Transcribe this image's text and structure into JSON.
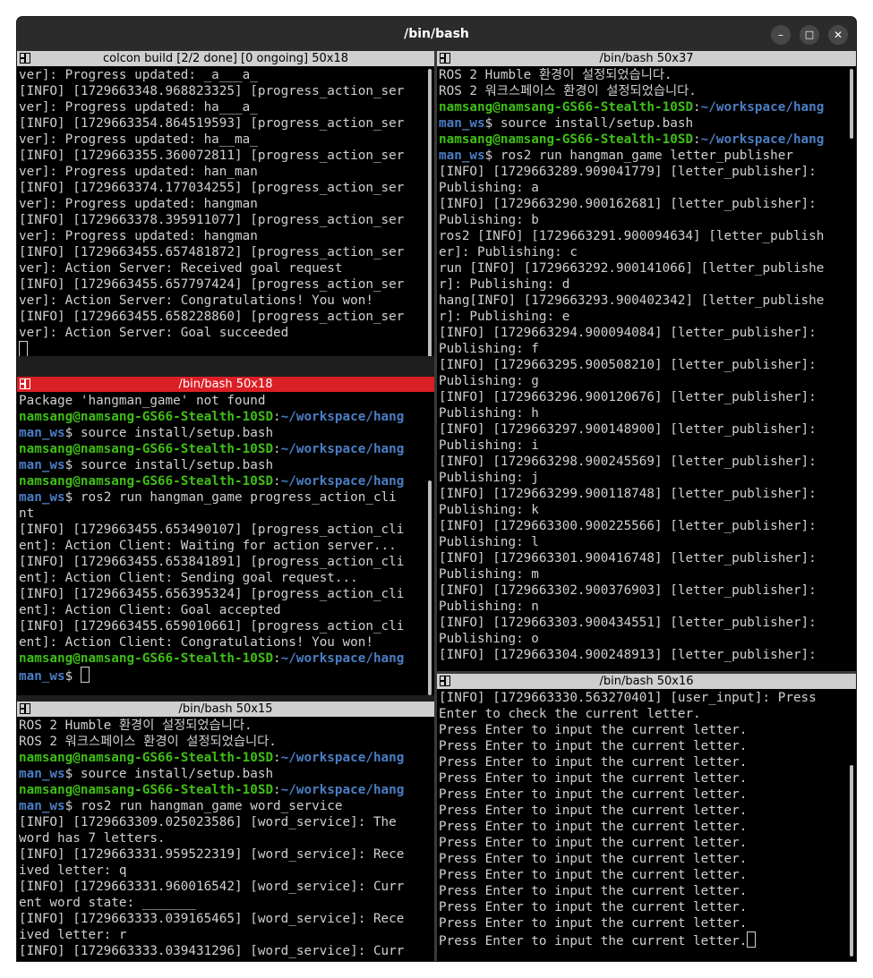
{
  "window": {
    "title": "/bin/bash",
    "minimize": "–",
    "maximize": "□",
    "close": "✕"
  },
  "panes": {
    "tl": {
      "title": "colcon build [2/2 done] [0 ongoing] 50x18",
      "lines": [
        [
          {
            "t": "ver]: Progress updated: _a___a_"
          }
        ],
        [
          {
            "t": "[INFO] [1729663348.968823325] [progress_action_ser"
          }
        ],
        [
          {
            "t": "ver]: Progress updated: ha___a_"
          }
        ],
        [
          {
            "t": "[INFO] [1729663354.864519593] [progress_action_ser"
          }
        ],
        [
          {
            "t": "ver]: Progress updated: ha__ma_"
          }
        ],
        [
          {
            "t": "[INFO] [1729663355.360072811] [progress_action_ser"
          }
        ],
        [
          {
            "t": "ver]: Progress updated: han_man"
          }
        ],
        [
          {
            "t": "[INFO] [1729663374.177034255] [progress_action_ser"
          }
        ],
        [
          {
            "t": "ver]: Progress updated: hangman"
          }
        ],
        [
          {
            "t": "[INFO] [1729663378.395911077] [progress_action_ser"
          }
        ],
        [
          {
            "t": "ver]: Progress updated: hangman"
          }
        ],
        [
          {
            "t": "[INFO] [1729663455.657481872] [progress_action_ser"
          }
        ],
        [
          {
            "t": "ver]: Action Server: Received goal request"
          }
        ],
        [
          {
            "t": "[INFO] [1729663455.657797424] [progress_action_ser"
          }
        ],
        [
          {
            "t": "ver]: Action Server: Congratulations! You won!"
          }
        ],
        [
          {
            "t": "[INFO] [1729663455.658228860] [progress_action_ser"
          }
        ],
        [
          {
            "t": "ver]: Action Server: Goal succeeded"
          }
        ]
      ]
    },
    "ml": {
      "title": "/bin/bash 50x18",
      "lines": [
        [
          {
            "t": "Package 'hangman_game' not found"
          }
        ],
        [
          {
            "t": "namsang@namsang-GS66-Stealth-10SD",
            "c": "g"
          },
          {
            "t": ":"
          },
          {
            "t": "~/workspace/hang",
            "c": "b"
          }
        ],
        [
          {
            "t": "man_ws",
            "c": "b"
          },
          {
            "t": "$ source install/setup.bash"
          }
        ],
        [
          {
            "t": "namsang@namsang-GS66-Stealth-10SD",
            "c": "g"
          },
          {
            "t": ":"
          },
          {
            "t": "~/workspace/hang",
            "c": "b"
          }
        ],
        [
          {
            "t": "man_ws",
            "c": "b"
          },
          {
            "t": "$ source install/setup.bash"
          }
        ],
        [
          {
            "t": "namsang@namsang-GS66-Stealth-10SD",
            "c": "g"
          },
          {
            "t": ":"
          },
          {
            "t": "~/workspace/hang",
            "c": "b"
          }
        ],
        [
          {
            "t": "man_ws",
            "c": "b"
          },
          {
            "t": "$ ros2 run hangman_game progress_action_cli"
          }
        ],
        [
          {
            "t": "nt"
          }
        ],
        [
          {
            "t": "[INFO] [1729663455.653490107] [progress_action_cli"
          }
        ],
        [
          {
            "t": "ent]: Action Client: Waiting for action server..."
          }
        ],
        [
          {
            "t": "[INFO] [1729663455.653841891] [progress_action_cli"
          }
        ],
        [
          {
            "t": "ent]: Action Client: Sending goal request..."
          }
        ],
        [
          {
            "t": "[INFO] [1729663455.656395324] [progress_action_cli"
          }
        ],
        [
          {
            "t": "ent]: Action Client: Goal accepted"
          }
        ],
        [
          {
            "t": "[INFO] [1729663455.659010661] [progress_action_cli"
          }
        ],
        [
          {
            "t": "ent]: Action Client: Congratulations! You won!"
          }
        ],
        [
          {
            "t": "namsang@namsang-GS66-Stealth-10SD",
            "c": "g"
          },
          {
            "t": ":"
          },
          {
            "t": "~/workspace/hang",
            "c": "b"
          }
        ],
        [
          {
            "t": "man_ws",
            "c": "b"
          },
          {
            "t": "$ "
          }
        ]
      ]
    },
    "bl": {
      "title": "/bin/bash 50x15",
      "lines": [
        [
          {
            "t": "ROS 2 Humble 환경이 설정되었습니다."
          }
        ],
        [
          {
            "t": "ROS 2 워크스페이스 환경이 설정되었습니다."
          }
        ],
        [
          {
            "t": "namsang@namsang-GS66-Stealth-10SD",
            "c": "g"
          },
          {
            "t": ":"
          },
          {
            "t": "~/workspace/hang",
            "c": "b"
          }
        ],
        [
          {
            "t": "man_ws",
            "c": "b"
          },
          {
            "t": "$ source install/setup.bash"
          }
        ],
        [
          {
            "t": "namsang@namsang-GS66-Stealth-10SD",
            "c": "g"
          },
          {
            "t": ":"
          },
          {
            "t": "~/workspace/hang",
            "c": "b"
          }
        ],
        [
          {
            "t": "man_ws",
            "c": "b"
          },
          {
            "t": "$ ros2 run hangman_game word_service"
          }
        ],
        [
          {
            "t": "[INFO] [1729663309.025023586] [word_service]: The"
          }
        ],
        [
          {
            "t": "word has 7 letters."
          }
        ],
        [
          {
            "t": "[INFO] [1729663331.959522319] [word_service]: Rece"
          }
        ],
        [
          {
            "t": "ived letter: q"
          }
        ],
        [
          {
            "t": "[INFO] [1729663331.960016542] [word_service]: Curr"
          }
        ],
        [
          {
            "t": "ent word state: _______"
          }
        ],
        [
          {
            "t": "[INFO] [1729663333.039165465] [word_service]: Rece"
          }
        ],
        [
          {
            "t": "ived letter: r"
          }
        ],
        [
          {
            "t": "[INFO] [1729663333.039431296] [word_service]: Curr"
          }
        ]
      ]
    },
    "tr": {
      "title": "/bin/bash 50x37",
      "lines": [
        [
          {
            "t": "ROS 2 Humble 환경이 설정되었습니다."
          }
        ],
        [
          {
            "t": "ROS 2 워크스페이스 환경이 설정되었습니다."
          }
        ],
        [
          {
            "t": "namsang@namsang-GS66-Stealth-10SD",
            "c": "g"
          },
          {
            "t": ":"
          },
          {
            "t": "~/workspace/hang",
            "c": "b"
          }
        ],
        [
          {
            "t": "man_ws",
            "c": "b"
          },
          {
            "t": "$ source install/setup.bash"
          }
        ],
        [
          {
            "t": "namsang@namsang-GS66-Stealth-10SD",
            "c": "g"
          },
          {
            "t": ":"
          },
          {
            "t": "~/workspace/hang",
            "c": "b"
          }
        ],
        [
          {
            "t": "man_ws",
            "c": "b"
          },
          {
            "t": "$ ros2 run hangman_game letter_publisher"
          }
        ],
        [
          {
            "t": "[INFO] [1729663289.909041779] [letter_publisher]:"
          }
        ],
        [
          {
            "t": "Publishing: a"
          }
        ],
        [
          {
            "t": "[INFO] [1729663290.900162681] [letter_publisher]:"
          }
        ],
        [
          {
            "t": "Publishing: b"
          }
        ],
        [
          {
            "t": "ros2 [INFO] [1729663291.900094634] [letter_publish"
          }
        ],
        [
          {
            "t": "er]: Publishing: c"
          }
        ],
        [
          {
            "t": "run [INFO] [1729663292.900141066] [letter_publishe"
          }
        ],
        [
          {
            "t": "r]: Publishing: d"
          }
        ],
        [
          {
            "t": "hang[INFO] [1729663293.900402342] [letter_publishe"
          }
        ],
        [
          {
            "t": "r]: Publishing: e"
          }
        ],
        [
          {
            "t": "[INFO] [1729663294.900094084] [letter_publisher]:"
          }
        ],
        [
          {
            "t": "Publishing: f"
          }
        ],
        [
          {
            "t": "[INFO] [1729663295.900508210] [letter_publisher]:"
          }
        ],
        [
          {
            "t": "Publishing: g"
          }
        ],
        [
          {
            "t": "[INFO] [1729663296.900120676] [letter_publisher]:"
          }
        ],
        [
          {
            "t": "Publishing: h"
          }
        ],
        [
          {
            "t": "[INFO] [1729663297.900148900] [letter_publisher]:"
          }
        ],
        [
          {
            "t": "Publishing: i"
          }
        ],
        [
          {
            "t": "[INFO] [1729663298.900245569] [letter_publisher]:"
          }
        ],
        [
          {
            "t": "Publishing: j"
          }
        ],
        [
          {
            "t": "[INFO] [1729663299.900118748] [letter_publisher]:"
          }
        ],
        [
          {
            "t": "Publishing: k"
          }
        ],
        [
          {
            "t": "[INFO] [1729663300.900225566] [letter_publisher]:"
          }
        ],
        [
          {
            "t": "Publishing: l"
          }
        ],
        [
          {
            "t": "[INFO] [1729663301.900416748] [letter_publisher]:"
          }
        ],
        [
          {
            "t": "Publishing: m"
          }
        ],
        [
          {
            "t": "[INFO] [1729663302.900376903] [letter_publisher]:"
          }
        ],
        [
          {
            "t": "Publishing: n"
          }
        ],
        [
          {
            "t": "[INFO] [1729663303.900434551] [letter_publisher]:"
          }
        ],
        [
          {
            "t": "Publishing: o"
          }
        ],
        [
          {
            "t": "[INFO] [1729663304.900248913] [letter_publisher]:"
          }
        ]
      ]
    },
    "br": {
      "title": "/bin/bash 50x16",
      "lines": [
        [
          {
            "t": "[INFO] [1729663330.563270401] [user_input]: Press"
          }
        ],
        [
          {
            "t": "Enter to check the current letter."
          }
        ],
        [
          {
            "t": "Press Enter to input the current letter."
          }
        ],
        [
          {
            "t": "Press Enter to input the current letter."
          }
        ],
        [
          {
            "t": "Press Enter to input the current letter."
          }
        ],
        [
          {
            "t": "Press Enter to input the current letter."
          }
        ],
        [
          {
            "t": "Press Enter to input the current letter."
          }
        ],
        [
          {
            "t": "Press Enter to input the current letter."
          }
        ],
        [
          {
            "t": "Press Enter to input the current letter."
          }
        ],
        [
          {
            "t": "Press Enter to input the current letter."
          }
        ],
        [
          {
            "t": "Press Enter to input the current letter."
          }
        ],
        [
          {
            "t": "Press Enter to input the current letter."
          }
        ],
        [
          {
            "t": "Press Enter to input the current letter."
          }
        ],
        [
          {
            "t": "Press Enter to input the current letter."
          }
        ],
        [
          {
            "t": "Press Enter to input the current letter."
          }
        ],
        [
          {
            "t": "Press Enter to input the current letter."
          }
        ]
      ]
    }
  }
}
